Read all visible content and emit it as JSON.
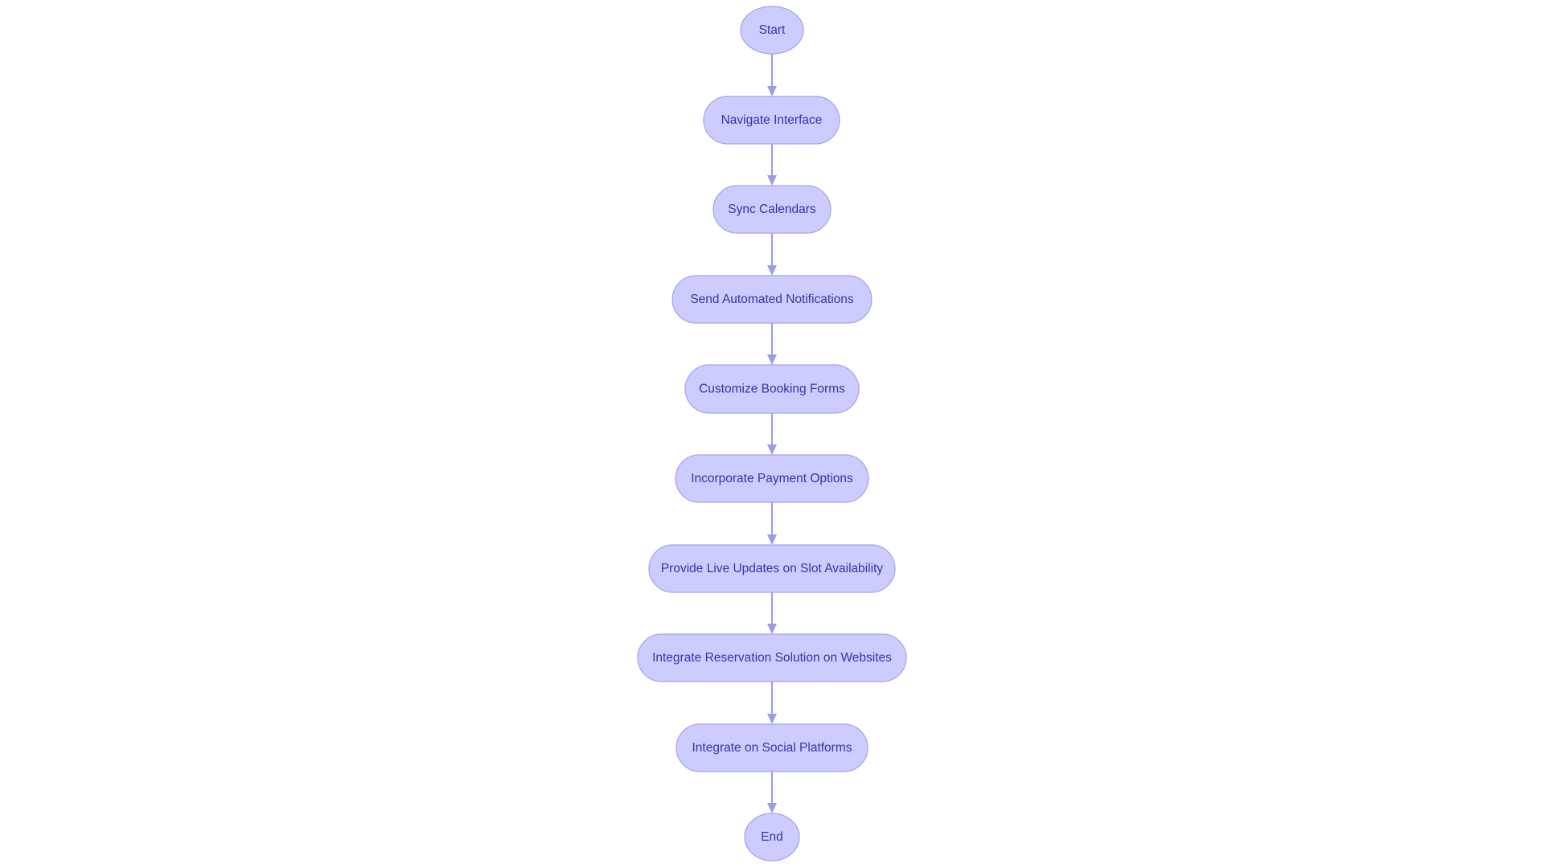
{
  "diagram": {
    "type": "flowchart",
    "direction": "top-to-bottom",
    "colors": {
      "node_fill": "#ccccff",
      "node_stroke": "#a3a3ee",
      "text": "#3535a8",
      "edge": "#9b9be8"
    },
    "nodes": [
      {
        "id": "start",
        "label": "Start",
        "shape": "circle"
      },
      {
        "id": "navigate",
        "label": "Navigate Interface",
        "shape": "stadium"
      },
      {
        "id": "sync",
        "label": "Sync Calendars",
        "shape": "stadium"
      },
      {
        "id": "notify",
        "label": "Send Automated Notifications",
        "shape": "stadium"
      },
      {
        "id": "forms",
        "label": "Customize Booking Forms",
        "shape": "stadium"
      },
      {
        "id": "payment",
        "label": "Incorporate Payment Options",
        "shape": "stadium"
      },
      {
        "id": "live",
        "label": "Provide Live Updates on Slot Availability",
        "shape": "stadium"
      },
      {
        "id": "websites",
        "label": "Integrate Reservation Solution on Websites",
        "shape": "stadium"
      },
      {
        "id": "social",
        "label": "Integrate on Social Platforms",
        "shape": "stadium"
      },
      {
        "id": "end",
        "label": "End",
        "shape": "circle"
      }
    ],
    "edges": [
      {
        "from": "start",
        "to": "navigate"
      },
      {
        "from": "navigate",
        "to": "sync"
      },
      {
        "from": "sync",
        "to": "notify"
      },
      {
        "from": "notify",
        "to": "forms"
      },
      {
        "from": "forms",
        "to": "payment"
      },
      {
        "from": "payment",
        "to": "live"
      },
      {
        "from": "live",
        "to": "websites"
      },
      {
        "from": "websites",
        "to": "social"
      },
      {
        "from": "social",
        "to": "end"
      }
    ]
  }
}
